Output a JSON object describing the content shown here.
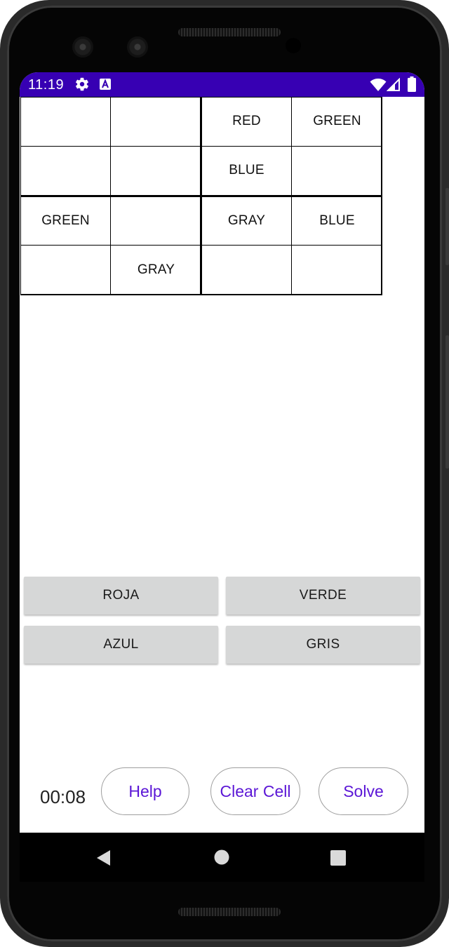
{
  "status_bar": {
    "time": "11:19",
    "icons": [
      "gear-icon",
      "a-icon",
      "wifi-icon",
      "signal-icon",
      "battery-icon"
    ],
    "color": "#3700b3"
  },
  "grid": {
    "rows": [
      [
        "",
        "",
        "RED",
        "GREEN"
      ],
      [
        "",
        "",
        "BLUE",
        ""
      ],
      [
        "GREEN",
        "",
        "GRAY",
        "BLUE"
      ],
      [
        "",
        "GRAY",
        "",
        ""
      ]
    ]
  },
  "choices": [
    "ROJA",
    "VERDE",
    "AZUL",
    "GRIS"
  ],
  "bottom": {
    "timer": "00:08",
    "help_label": "Help",
    "clear_label": "Clear Cell",
    "solve_label": "Solve"
  },
  "nav_icons": [
    "back-icon",
    "home-icon",
    "recents-icon"
  ],
  "colors": {
    "accent_text": "#5b16d6",
    "button_bg": "#d6d7d7"
  }
}
